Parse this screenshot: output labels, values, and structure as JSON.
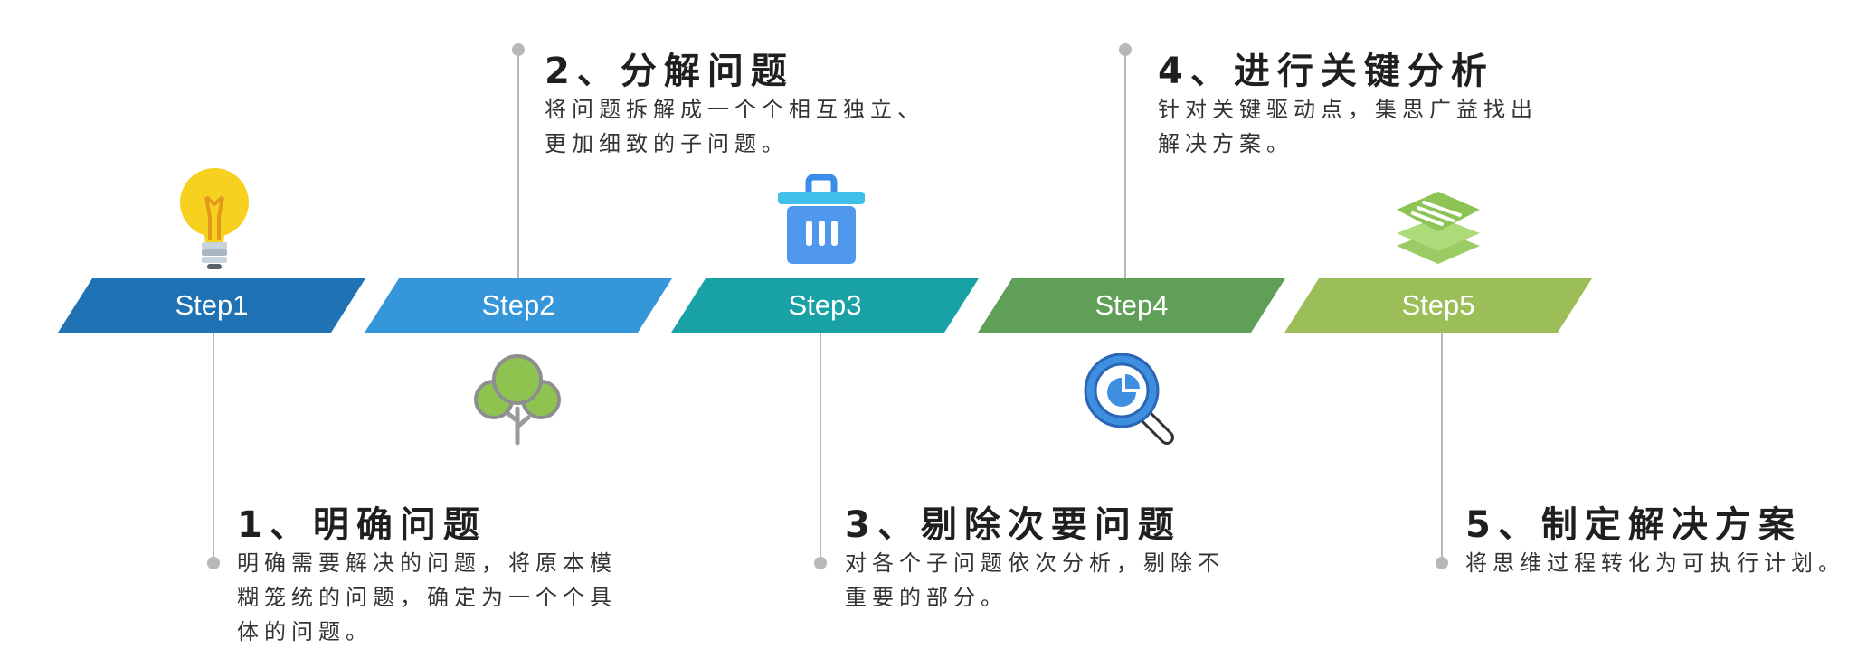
{
  "steps": [
    {
      "label": "Step1",
      "title": "1、明确问题",
      "desc": "明确需要解决的问题，将原本模糊笼统的问题，确定为一个个具体的问题。",
      "color": "#1f72b3",
      "icon": "lightbulb-icon"
    },
    {
      "label": "Step2",
      "title": "2、分解问题",
      "desc": "将问题拆解成一个个相互独立、更加细致的子问题。",
      "color": "#3596da",
      "icon": "tree-icon"
    },
    {
      "label": "Step3",
      "title": "3、剔除次要问题",
      "desc": "对各个子问题依次分析，剔除不重要的部分。",
      "color": "#18a2a5",
      "icon": "trash-bin-icon"
    },
    {
      "label": "Step4",
      "title": "4、进行关键分析",
      "desc": "针对关键驱动点，集思广益找出解决方案。",
      "color": "#5f9f58",
      "icon": "magnifier-chart-icon"
    },
    {
      "label": "Step5",
      "title": "5、制定解决方案",
      "desc": "将思维过程转化为可执行计划。",
      "color": "#9bbe58",
      "icon": "document-stack-icon"
    }
  ]
}
